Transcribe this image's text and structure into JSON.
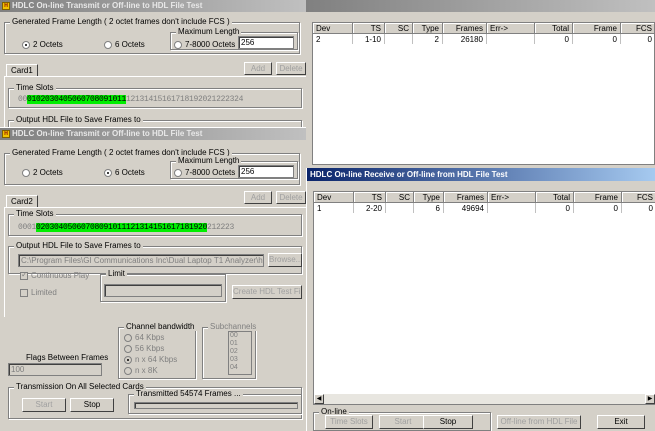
{
  "tx1": {
    "title": "HDLC On-line Transmit or Off-line to HDL File Test",
    "frame_group": "Generated Frame Length ( 2 octet frames don't include FCS )",
    "opt2": "2 Octets",
    "opt6": "6 Octets",
    "optmax": "7-8000 Octets",
    "max_label": "Maximum Length",
    "max_value": "256",
    "tab": "Card1",
    "add": "Add",
    "delete": "Delete",
    "ts_label": "Time Slots",
    "ts_pre": "00",
    "ts_sel": "0102030405060708091011",
    "ts_post": "12131415161718192021222324",
    "out_label": "Output HDL File to Save Frames to"
  },
  "tx2": {
    "title": "HDLC On-line Transmit or Off-line to HDL File Test",
    "frame_group": "Generated Frame Length ( 2 octet frames don't include FCS )",
    "opt2": "2 Octets",
    "opt6": "6 Octets",
    "optmax": "7-8000 Octets",
    "max_label": "Maximum Length",
    "max_value": "256",
    "tab": "Card2",
    "add": "Add",
    "delete": "Delete",
    "ts_label": "Time Slots",
    "ts_pre": "0001",
    "ts_sel": "02030405060708091011121314151617181920",
    "ts_post": "212223",
    "out_label": "Output HDL File to Save Frames to",
    "out_path": "C:\\Program Files\\GI Communications Inc\\Dual Laptop T1 Analyzer\\hdlc_odn",
    "browse": "Browse...",
    "continuous": "Continuous Play",
    "limited": "Limited",
    "limit_label": "Limit",
    "create": "Create HDL Test File",
    "bw_label": "Channel bandwidth",
    "bw64": "64 Kbps",
    "bw56": "56 Kbps",
    "bwn64": "n x 64 Kbps",
    "bwn8": "n x 8K",
    "sub_label": "Subchannels",
    "subs": [
      "00",
      "01",
      "02",
      "03",
      "04"
    ],
    "flags_label": "Flags Between Frames",
    "flags_value": "100",
    "trans_label": "Transmission On All Selected Cards",
    "start": "Start",
    "stop": "Stop",
    "transmitted": "Transmitted 54574 Frames ..."
  },
  "rx1": {
    "headers": [
      "Dev",
      "TS",
      "SC",
      "Type",
      "Frames",
      "Err->",
      "Total",
      "Frame",
      "FCS"
    ],
    "row": [
      "2",
      "1-10",
      "",
      "2",
      "26180",
      "",
      "0",
      "0",
      "0"
    ]
  },
  "rx2": {
    "title": "HDLC On-line Receive or Off-line from HDL File Test",
    "headers": [
      "Dev",
      "TS",
      "SC",
      "Type",
      "Frames",
      "Err->",
      "Total",
      "Frame",
      "FCS"
    ],
    "row": [
      "1",
      "2-20",
      "",
      "6",
      "49694",
      "",
      "0",
      "0",
      "0"
    ],
    "online": "On-line",
    "timeslots": "Time Slots",
    "start": "Start",
    "stop": "Stop",
    "offline": "Off-line from HDL File",
    "exit": "Exit"
  }
}
